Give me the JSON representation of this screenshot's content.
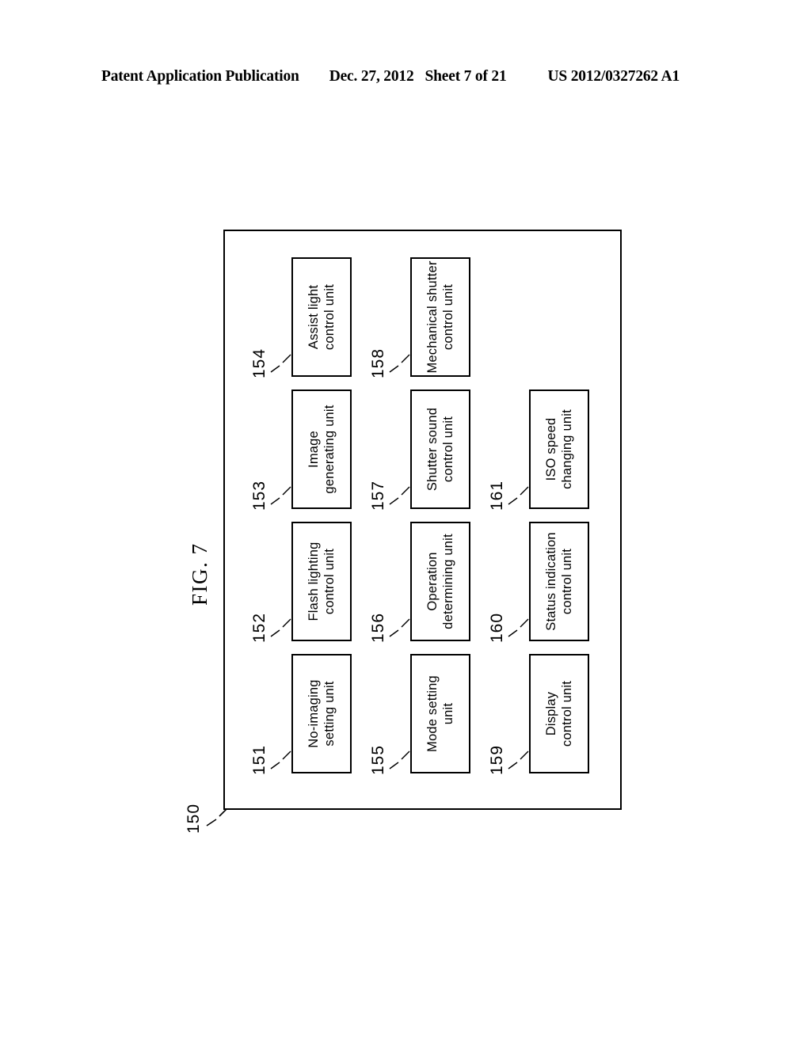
{
  "header": {
    "publication": "Patent Application Publication",
    "date": "Dec. 27, 2012",
    "sheet": "Sheet 7 of 21",
    "patent_number": "US 2012/0327262 A1"
  },
  "figure": {
    "caption": "FIG. 7",
    "outer_block": {
      "ref": "150"
    },
    "rows": [
      {
        "units": [
          {
            "ref": "151",
            "line1": "No-imaging",
            "line2": "setting unit"
          },
          {
            "ref": "152",
            "line1": "Flash lighting",
            "line2": "control unit"
          },
          {
            "ref": "153",
            "line1": "Image",
            "line2": "generating unit"
          },
          {
            "ref": "154",
            "line1": "Assist light",
            "line2": "control unit"
          }
        ]
      },
      {
        "units": [
          {
            "ref": "155",
            "line1": "Mode setting",
            "line2": "unit"
          },
          {
            "ref": "156",
            "line1": "Operation",
            "line2": "determining unit"
          },
          {
            "ref": "157",
            "line1": "Shutter sound",
            "line2": "control unit"
          },
          {
            "ref": "158",
            "line1": "Mechanical shutter",
            "line2": "control unit"
          }
        ]
      },
      {
        "units": [
          {
            "ref": "159",
            "line1": "Display",
            "line2": "control unit"
          },
          {
            "ref": "160",
            "line1": "Status indication",
            "line2": "control unit"
          },
          {
            "ref": "161",
            "line1": "ISO speed",
            "line2": "changing unit"
          }
        ]
      }
    ]
  }
}
